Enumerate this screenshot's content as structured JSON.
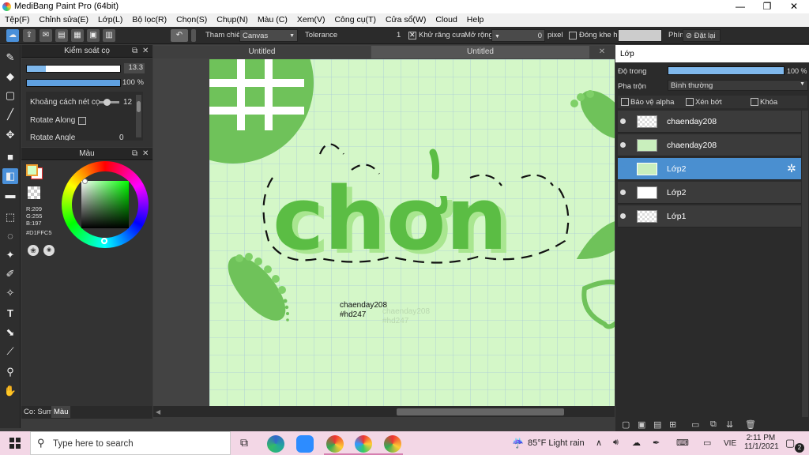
{
  "window": {
    "title": "MediBang Paint Pro (64bit)",
    "minimize": "—",
    "maximize": "❐",
    "close": "✕"
  },
  "menu": [
    "Tệp(F)",
    "Chỉnh sửa(E)",
    "Lớp(L)",
    "Bộ lọc(R)",
    "Chọn(S)",
    "Chụp(N)",
    "Màu (C)",
    "Xem(V)",
    "Công cụ(T)",
    "Cửa sổ(W)",
    "Cloud",
    "Help"
  ],
  "toolbar": {
    "ref_label": "Tham chiếu",
    "ref_value": "Canvas",
    "tolerance_label": "Tolerance",
    "tolerance_value": "1",
    "tolerance_fraction": 0.0,
    "antialias_label": "Khử răng cưa",
    "expand_label": "Mở rộng",
    "expand_value": "0",
    "expand_unit": "pixel",
    "close_gap_label": "Đóng khe hở",
    "keys_label": "Phím",
    "reset_label": "Đặt lại"
  },
  "brush_panel": {
    "title": "Kiểm soát cọ",
    "size_value": "13.3",
    "size_fraction": 0.2,
    "opacity_value": "100 %",
    "opacity_fraction": 1.0,
    "spacing_label": "Khoảng cách nét cọ",
    "spacing_value": "12",
    "rotate_along_label": "Rotate Along",
    "rotate_angle_label": "Rotate Angle",
    "rotate_angle_value": "0"
  },
  "color_panel": {
    "title": "Màu",
    "r": "R:209",
    "g": "G:255",
    "b": "B:197",
    "hex": "#D1FFC5",
    "fg_color": "#D1FFC5"
  },
  "bottom_tabs": [
    "Co: Sumi",
    "Màu"
  ],
  "canvas": {
    "tabs": [
      "Untitled",
      "Untitled"
    ],
    "bg_color": "#d4f7c8",
    "artwork_text": "chơn",
    "watermark1": "chaenday208",
    "watermark2": "#hd247",
    "watermark3": "chaenday208",
    "watermark4": "#hd247"
  },
  "layer_panel": {
    "title": "Lớp",
    "opacity_label": "Độ trong",
    "opacity_value": "100 %",
    "opacity_fraction": 1.0,
    "blend_label": "Pha trộn",
    "blend_value": "Bình thường",
    "protect_alpha": "Bảo vệ alpha",
    "clipping": "Xén bớt",
    "lock": "Khóa",
    "layers": [
      {
        "name": "chaenday208",
        "selected": false
      },
      {
        "name": "chaenday208",
        "selected": false
      },
      {
        "name": "Lớp2",
        "selected": true
      },
      {
        "name": "Lớp2",
        "selected": false
      },
      {
        "name": "Lớp1",
        "selected": false
      }
    ]
  },
  "taskbar": {
    "search_placeholder": "Type here to search",
    "weather": "85°F  Light rain",
    "lang": "VIE",
    "time": "2:11 PM",
    "date": "11/1/2021",
    "notifications": "2"
  }
}
